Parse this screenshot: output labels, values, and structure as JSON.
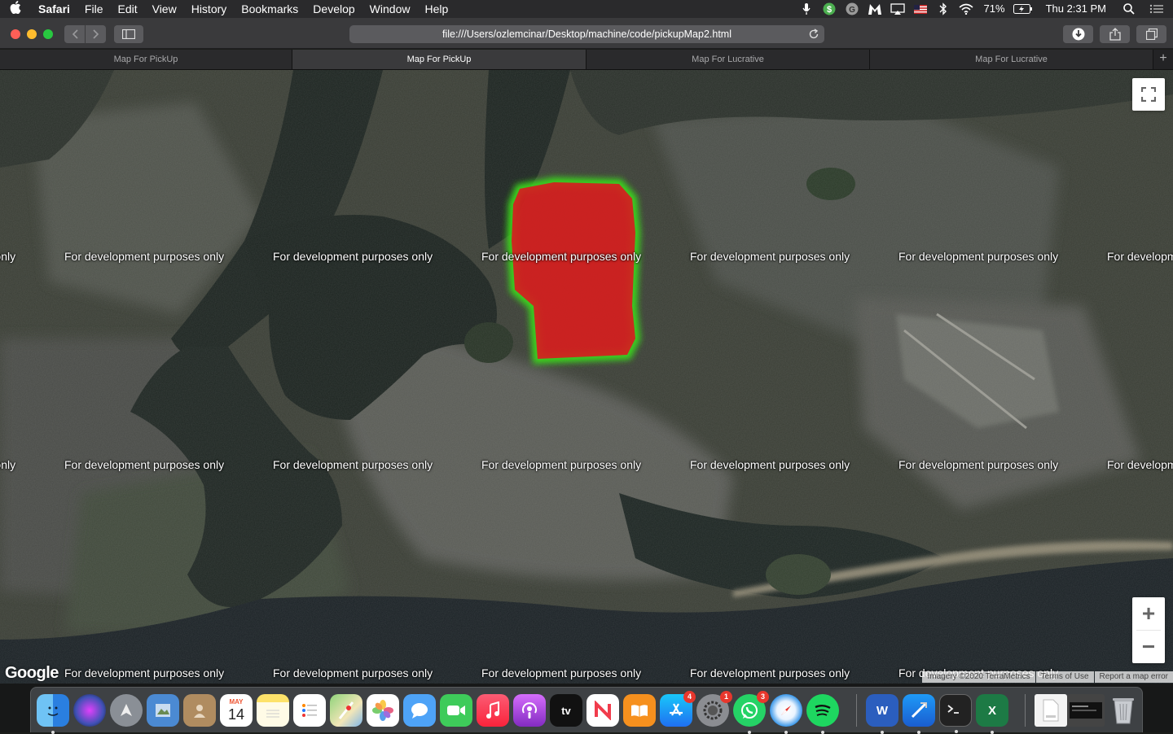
{
  "menubar": {
    "app_name": "Safari",
    "items": [
      "File",
      "Edit",
      "View",
      "History",
      "Bookmarks",
      "Develop",
      "Window",
      "Help"
    ],
    "battery": "71%",
    "clock": "Thu 2:31 PM"
  },
  "toolbar": {
    "url": "file:///Users/ozlemcinar/Desktop/machine/code/pickupMap2.html"
  },
  "tabs": [
    {
      "label": "Map For PickUp",
      "active": false
    },
    {
      "label": "Map For PickUp",
      "active": true
    },
    {
      "label": "Map For Lucrative",
      "active": false
    },
    {
      "label": "Map For Lucrative",
      "active": false
    }
  ],
  "map": {
    "watermark_text": "For development purposes only",
    "logo": "Google",
    "attribution": {
      "imagery": "Imagery ©2020 TerraMetrics",
      "terms": "Terms of Use",
      "report": "Report a map error"
    },
    "zoom_in": "+",
    "zoom_out": "−",
    "heat_region_color": "#d41f1f",
    "heat_edge_color": "#3bd41f"
  },
  "dock": {
    "calendar_month": "MAY",
    "calendar_day": "14",
    "appstore_badge": "4",
    "prefs_badge": "1",
    "whatsapp_badge": "3",
    "tv_label": "tv",
    "word_label": "W",
    "excel_label": "X"
  }
}
